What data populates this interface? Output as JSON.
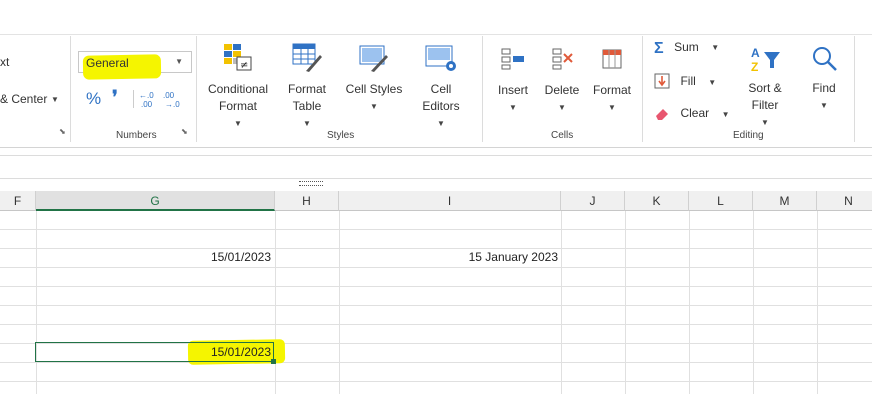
{
  "ribbon": {
    "alignment": {
      "wrap_text_partial": "xt",
      "merge_center_partial": "& Center"
    },
    "number": {
      "format_value": "General",
      "group_label": "Numbers",
      "percent_glyph": "%",
      "comma_glyph": "❜"
    },
    "styles": {
      "group_label": "Styles",
      "conditional_format": [
        "Conditional",
        "Format"
      ],
      "format_table": [
        "Format",
        "Table"
      ],
      "cell_styles": "Cell Styles",
      "cell_editors": [
        "Cell",
        "Editors"
      ]
    },
    "cells": {
      "group_label": "Cells",
      "insert": "Insert",
      "delete": "Delete",
      "format": "Format"
    },
    "editing": {
      "group_label": "Editing",
      "sum": "Sum",
      "fill": "Fill",
      "clear": "Clear",
      "sort_filter": [
        "Sort &",
        "Filter"
      ],
      "find": "Find"
    }
  },
  "grid": {
    "columns": [
      "F",
      "G",
      "H",
      "I",
      "J",
      "K",
      "L",
      "M",
      "N"
    ],
    "selected_column": "G",
    "cells": {
      "g_row2": "15/01/2023",
      "i_row2": "15 January 2023",
      "g_selected": "15/01/2023"
    }
  },
  "colors": {
    "accent_green": "#217346",
    "highlight_yellow": "#f5f500",
    "icon_blue": "#2f72c4"
  }
}
